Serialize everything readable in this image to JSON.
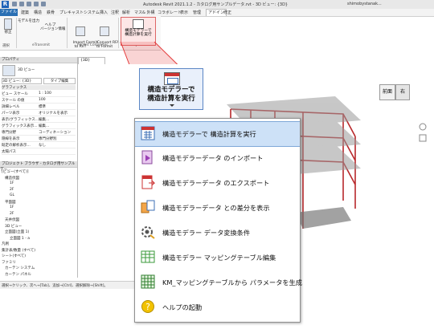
{
  "window": {
    "title": "Autodesk Revit 2021.1.2 - カタログ用サンプルデータ.rvt - 3D ビュー: {3D}",
    "user": "shimobystanak..."
  },
  "menu": {
    "file_label": "ファイル",
    "tabs": [
      "建築",
      "構造",
      "鉄骨",
      "プレキャスト",
      "システム",
      "挿入",
      "注釈",
      "解析",
      "マス& 外構",
      "コラボレート",
      "表示",
      "管理",
      "アドイン",
      "修正"
    ],
    "active_tab": "アドイン"
  },
  "ribbon": {
    "buttons": [
      {
        "label": "修正"
      },
      {
        "label": "モデルを出力"
      },
      {
        "label": "ヘルプ\nバージョン情報"
      },
      {
        "label": "Import Formit\nto RVT"
      },
      {
        "label": "Convert RFA\nto Formit"
      },
      {
        "label": "構造モデラーで\n構造計算を実行"
      }
    ],
    "groups": [
      "選択",
      "eTransmit",
      "Formit Converter",
      "KizzoSystem"
    ]
  },
  "properties": {
    "header": "プロパティ",
    "type_name": "3D ビュー",
    "selector": "3D ビュー: {3D}",
    "edit_type": "タイプ編集",
    "section": "グラフィックス",
    "rows": [
      {
        "name": "ビュー スケール",
        "value": "1 : 100"
      },
      {
        "name": "スケール の値",
        "value": "100"
      },
      {
        "name": "詳細レベル",
        "value": "標準"
      },
      {
        "name": "パーツ表示",
        "value": "オリジナルを表示"
      },
      {
        "name": "表示/グラフィックス...",
        "value": "編集..."
      },
      {
        "name": "グラフィックス表示...",
        "value": "編集..."
      },
      {
        "name": "専門分野",
        "value": "コーディネーション"
      },
      {
        "name": "隠線を表示",
        "value": "専門分野別"
      },
      {
        "name": "既定の解析表示...",
        "value": "なし"
      },
      {
        "name": "太陽パス",
        "value": ""
      }
    ]
  },
  "browser": {
    "header": "プロジェクト ブラウザ - カタログ用サンプルデー...",
    "items": [
      "[ビュー(すべて)]",
      "構造伏図",
      "1F",
      "2F",
      "GL",
      "平面図",
      "1F",
      "2F",
      "天井伏図",
      "3D ビュー",
      "立面図(立面 1)",
      "立面図 1 - a",
      "凡例",
      "集計表/数量 (すべて)",
      "シート(すべて)",
      "ファミリ",
      "カーテン システム",
      "カーテン パネル"
    ]
  },
  "status": {
    "text": "選択→クリック、次へ→[Tab]、追加→[Ctrl]、選択解除→[Shift]。"
  },
  "viewport": {
    "tab_label": "{3D}",
    "viewcube": {
      "front": "前面",
      "right": "右"
    }
  },
  "zoom_button": {
    "icon": "km-icon",
    "label_line1": "構造モデラーで",
    "label_line2": "構造計算を実行"
  },
  "dropdown": {
    "items": [
      {
        "icon": "structural-calc-icon",
        "label": "構造モデラーで 構造計算を実行",
        "selected": true
      },
      {
        "icon": "import-data-icon",
        "label": "構造モデラーデータ のインポート",
        "selected": false
      },
      {
        "icon": "export-data-icon",
        "label": "構造モデラーデータ のエクスポート",
        "selected": false
      },
      {
        "icon": "diff-icon",
        "label": "構造モデラーデータ との差分を表示",
        "selected": false
      },
      {
        "icon": "gear-icon",
        "label": "構造モデラー データ変換条件",
        "selected": false
      },
      {
        "icon": "table-edit-icon",
        "label": "構造モデラー マッピングテーブル編集",
        "selected": false
      },
      {
        "icon": "grid-params-icon",
        "label": "KM_マッピングテーブルから パラメータを生成",
        "selected": false
      },
      {
        "icon": "help-icon",
        "label": "ヘルプの起動",
        "selected": false
      }
    ]
  },
  "colors": {
    "accent": "#2a6fb3",
    "highlight": "#cde1f7",
    "callout": "#e43b3b",
    "steel": "#b8282b"
  }
}
